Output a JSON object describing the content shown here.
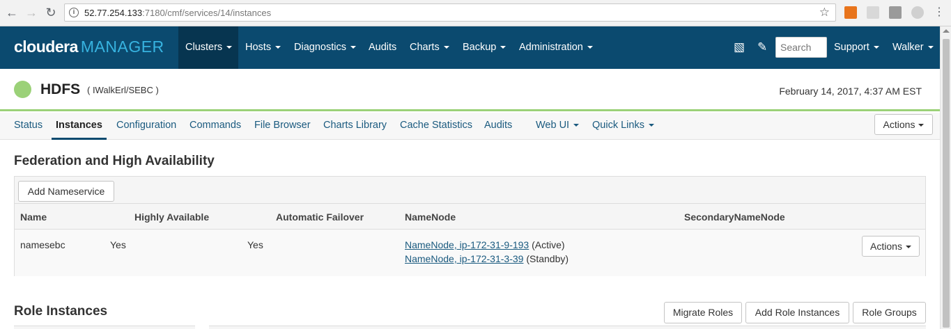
{
  "browser": {
    "url_host": "52.77.254.133",
    "url_path": ":7180/cmf/services/14/instances"
  },
  "topnav": {
    "logo_main": "cloudera",
    "logo_sub": "MANAGER",
    "items": [
      "Clusters",
      "Hosts",
      "Diagnostics",
      "Audits",
      "Charts",
      "Backup",
      "Administration"
    ],
    "search_placeholder": "Search",
    "support": "Support",
    "user": "Walker"
  },
  "service": {
    "name": "HDFS",
    "cluster": "( IWalkErl/SEBC )",
    "timestamp": "February 14, 2017, 4:37 AM EST",
    "status_color": "#9bd178"
  },
  "subtabs": {
    "items": [
      "Status",
      "Instances",
      "Configuration",
      "Commands",
      "File Browser",
      "Charts Library",
      "Cache Statistics",
      "Audits",
      "Web UI",
      "Quick Links"
    ],
    "active": "Instances",
    "actions": "Actions"
  },
  "federation": {
    "title": "Federation and High Availability",
    "add_button": "Add Nameservice",
    "columns": [
      "Name",
      "Highly Available",
      "Automatic Failover",
      "NameNode",
      "SecondaryNameNode"
    ],
    "row": {
      "name": "namesebc",
      "highly_available": "Yes",
      "automatic_failover": "Yes",
      "namenode_1": "NameNode, ip-172-31-9-193",
      "namenode_1_state": "(Active)",
      "namenode_2": "NameNode, ip-172-31-3-39",
      "namenode_2_state": "(Standby)",
      "actions": "Actions"
    }
  },
  "role_instances": {
    "title": "Role Instances",
    "migrate": "Migrate Roles",
    "add": "Add Role Instances",
    "groups": "Role Groups"
  }
}
